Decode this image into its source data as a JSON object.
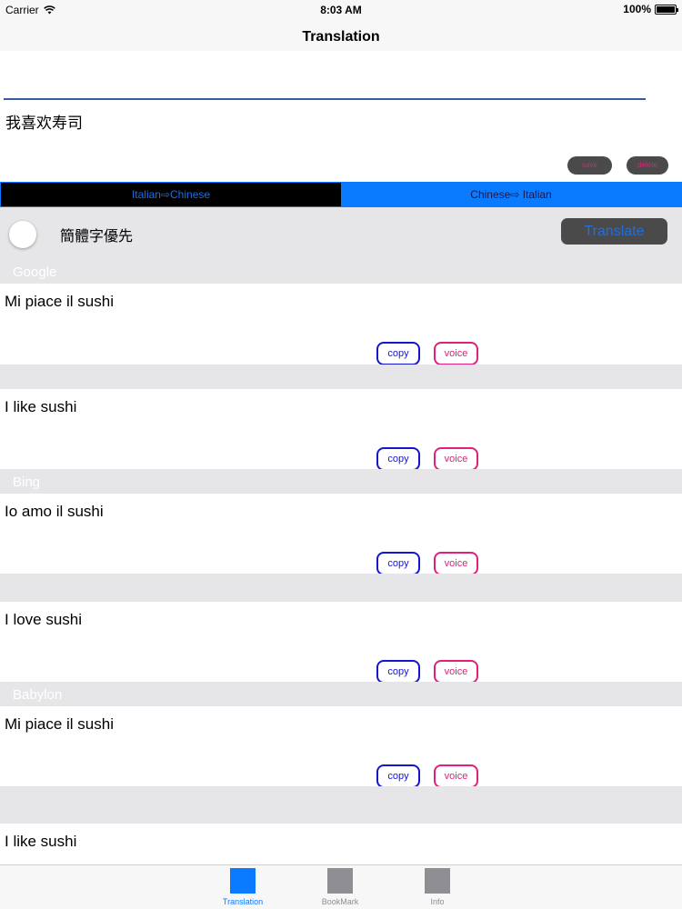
{
  "status_bar": {
    "carrier": "Carrier",
    "time": "8:03 AM",
    "battery": "100%"
  },
  "nav": {
    "title": "Translation"
  },
  "source": {
    "text": "我喜欢寿司",
    "save_label": "save",
    "delete_label": "delete"
  },
  "segmented": {
    "left_label": "Italian⇨Chinese",
    "right_label": "Chinese⇨ Italian"
  },
  "options": {
    "simplified_label": "簡體字優先",
    "translate_label": "Translate"
  },
  "sections": [
    {
      "label": "Google"
    },
    {
      "label": "Bing"
    },
    {
      "label": "Babylon"
    }
  ],
  "results": [
    {
      "text": "Mi piace il sushi",
      "copy": "copy",
      "voice": "voice"
    },
    {
      "text": "I like sushi",
      "copy": "copy",
      "voice": "voice"
    },
    {
      "text": "Io amo il sushi",
      "copy": "copy",
      "voice": "voice"
    },
    {
      "text": "I love sushi",
      "copy": "copy",
      "voice": "voice"
    },
    {
      "text": "Mi piace il sushi",
      "copy": "copy",
      "voice": "voice"
    },
    {
      "text": "I like sushi"
    }
  ],
  "tabs": [
    {
      "label": "Translation"
    },
    {
      "label": "BookMark"
    },
    {
      "label": "Info"
    }
  ],
  "colors": {
    "accent": "#0a7aff",
    "copy": "#1515d0",
    "voice": "#e0207a"
  }
}
